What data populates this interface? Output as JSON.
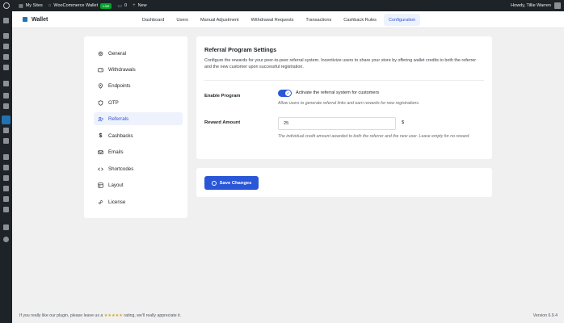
{
  "adminbar": {
    "my_sites": "My Sites",
    "site_name": "WooCommerce Wallet",
    "live_badge": "Live",
    "comments": "0",
    "new": "New",
    "howdy": "Howdy, Tillie Warren"
  },
  "plugin": {
    "title": "Wallet",
    "tabs": [
      {
        "label": "Dashboard"
      },
      {
        "label": "Users"
      },
      {
        "label": "Manual Adjustment"
      },
      {
        "label": "Withdrawal Requests"
      },
      {
        "label": "Transactions"
      },
      {
        "label": "Cashback Rules"
      },
      {
        "label": "Configuration",
        "active": true
      }
    ]
  },
  "nav": {
    "items": [
      {
        "label": "General",
        "icon": "gear-icon"
      },
      {
        "label": "Withdrawals",
        "icon": "wallet-icon"
      },
      {
        "label": "Endpoints",
        "icon": "location-icon"
      },
      {
        "label": "OTP",
        "icon": "shield-icon"
      },
      {
        "label": "Referrals",
        "icon": "user-plus-icon",
        "active": true
      },
      {
        "label": "Cashbacks",
        "icon": "dollar-icon"
      },
      {
        "label": "Emails",
        "icon": "mail-icon"
      },
      {
        "label": "Shortcodes",
        "icon": "code-icon"
      },
      {
        "label": "Layout",
        "icon": "layout-icon"
      },
      {
        "label": "License",
        "icon": "link-icon"
      }
    ]
  },
  "referral": {
    "title": "Referral Program Settings",
    "description": "Configure the rewards for your peer-to-peer referral system. Incentivize users to share your store by offering wallet credits to both the referrer and the new customer upon successful registration.",
    "enable_label": "Enable Program",
    "enable_text": "Activate the referral system for customers",
    "enable_help": "Allow users to generate referral links and earn rewards for new registrations.",
    "enabled": true,
    "amount_label": "Reward Amount",
    "amount_value": "25",
    "amount_unit": "$",
    "amount_help": "The individual credit amount awarded to both the referrer and the new user. Leave empty for no reward."
  },
  "save": {
    "label": "Save Changes"
  },
  "footer": {
    "text_before": "If you really like our plugin, please leave us a",
    "stars": "★★★★★",
    "text_after": "rating, we'll really appreciate it.",
    "version": "Version 6.9.4"
  },
  "colors": {
    "accent": "#2a57d8",
    "adminbar": "#1d2327",
    "active_bg": "#eef2fc"
  }
}
